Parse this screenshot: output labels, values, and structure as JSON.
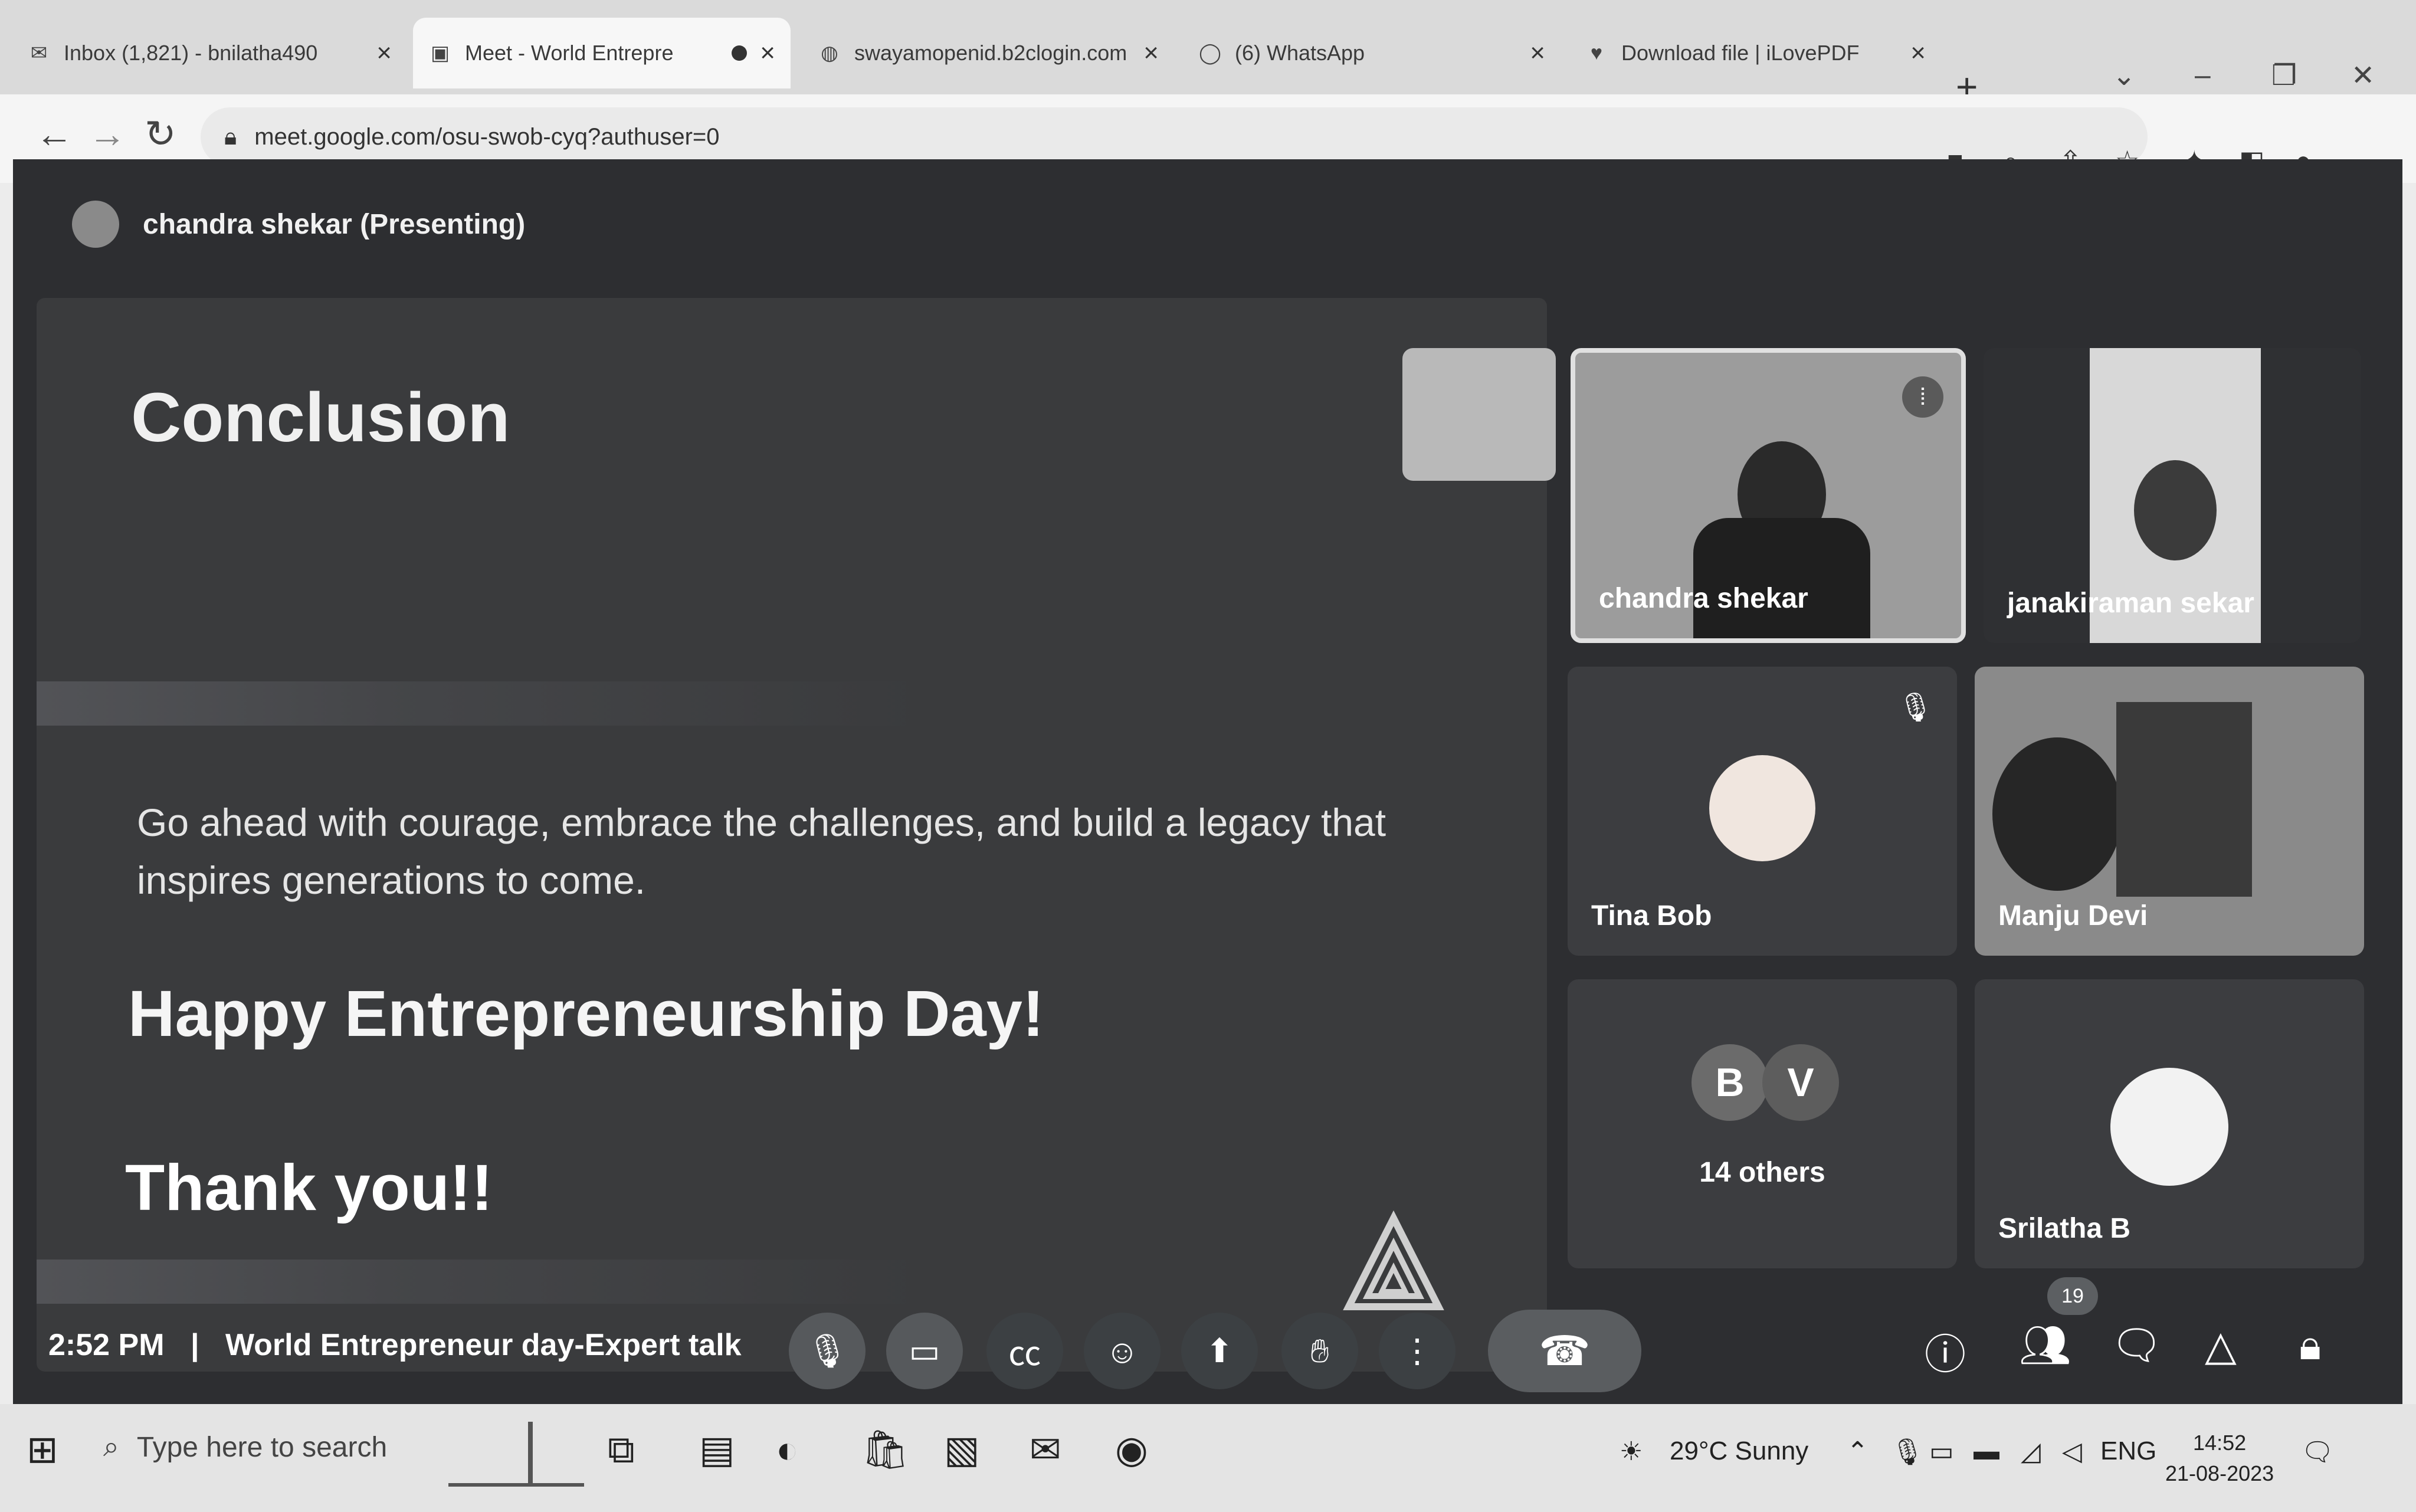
{
  "browser": {
    "tabs": [
      {
        "label": "Inbox (1,821) - bnilatha490",
        "icon": "gmail-icon"
      },
      {
        "label": "Meet - World Entrepre",
        "icon": "meet-icon"
      },
      {
        "label": "swayamopenid.b2clogin.com",
        "icon": "globe-icon"
      },
      {
        "label": "(6) WhatsApp",
        "icon": "whatsapp-icon"
      },
      {
        "label": "Download file | iLovePDF",
        "icon": "pdf-icon"
      }
    ],
    "url": "meet.google.com/osu-swob-cyq?authuser=0"
  },
  "meet": {
    "presenter_label": "chandra shekar (Presenting)",
    "slide": {
      "heading": "Conclusion",
      "body": "Go ahead with courage, embrace the challenges, and build a legacy that inspires generations to come.",
      "greeting": "Happy Entrepreneurship Day!",
      "closing": "Thank you!!"
    },
    "participants": [
      {
        "name": "chandra shekar",
        "speaking": true
      },
      {
        "name": "janakiraman sekar"
      },
      {
        "name": "Tina Bob",
        "muted": true
      },
      {
        "name": "Manju Devi"
      },
      {
        "name": "Srilatha B"
      }
    ],
    "others": {
      "initials": [
        "B",
        "V"
      ],
      "label": "14 others"
    },
    "time": "2:52 PM",
    "separator": "|",
    "meeting_title": "World Entrepreneur day-Expert talk",
    "participant_count": "19"
  },
  "taskbar": {
    "search_placeholder": "Type here to search",
    "weather": "29°C  Sunny",
    "language": "ENG",
    "clock_time": "14:52",
    "clock_date": "21-08-2023"
  },
  "colors": {
    "meet_bg": "#2d2e31",
    "slide_bg": "#3a3b3d",
    "tile_bg": "#3c3d40",
    "control_bg": "#3c4043"
  }
}
